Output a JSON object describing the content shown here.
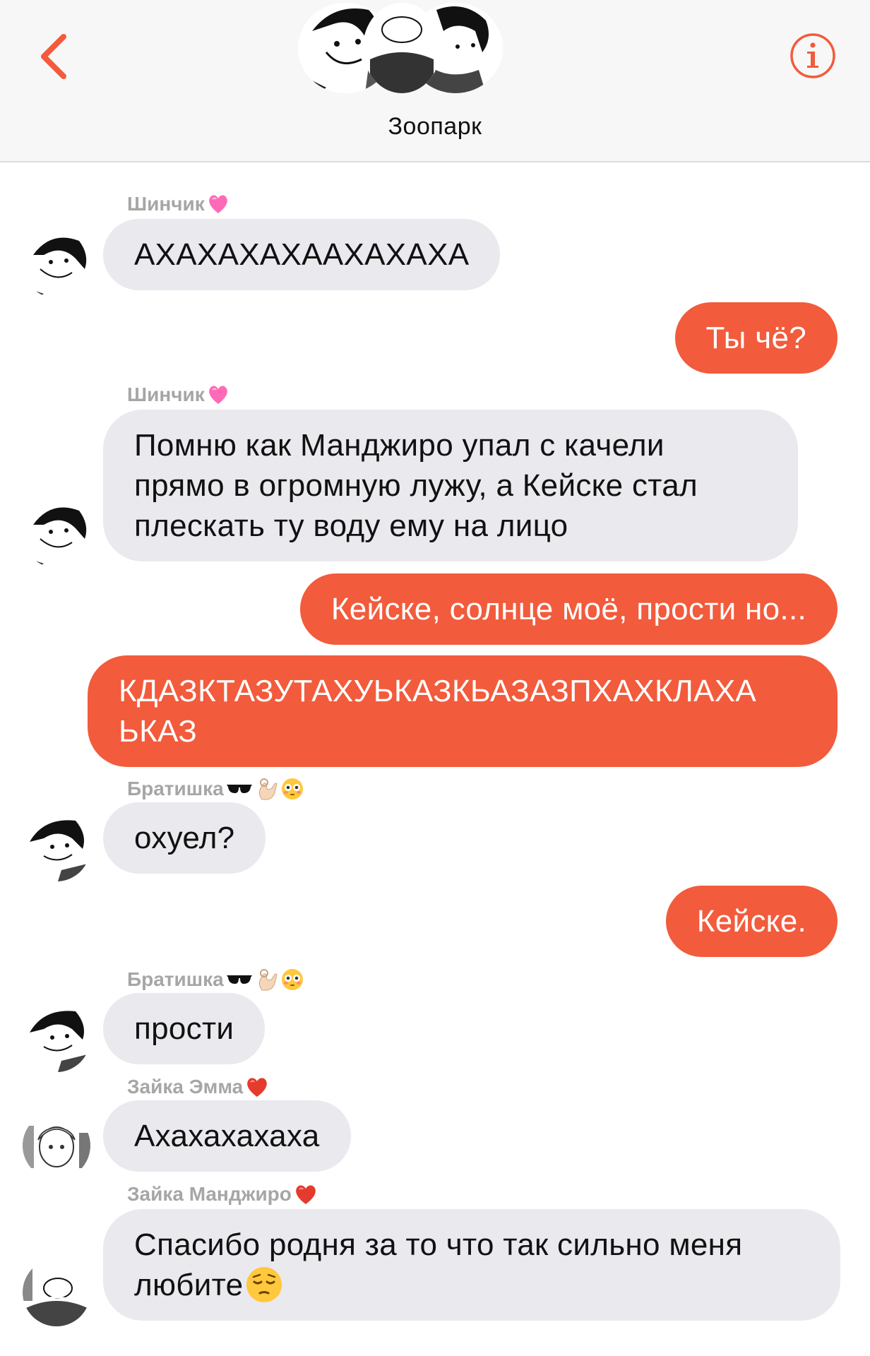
{
  "header": {
    "title": "Зоопарк",
    "back_icon": "chevron-left-icon",
    "info_icon": "info-circle-icon",
    "accent_color": "#f25b3c"
  },
  "messages": [
    {
      "side": "in",
      "sender": "Шинчик",
      "sender_emoji": [
        "pink-heart-emoji"
      ],
      "text": "АХАХАХАХААХАХАХА"
    },
    {
      "side": "out",
      "text": "Ты чё?"
    },
    {
      "side": "in",
      "sender": "Шинчик",
      "sender_emoji": [
        "pink-heart-emoji"
      ],
      "lines": [
        "Помню как Манджиро упал с качели",
        "прямо в огромную лужу, а Кейске стал",
        "плескать ту воду ему на лицо"
      ]
    },
    {
      "side": "out",
      "text": "Кейске, солнце моё, прости но..."
    },
    {
      "side": "out",
      "lines": [
        "КДАЗКТАЗУТАХУЬКАЗКЬАЗАЗПХАХКЛАХА",
        "ЬКАЗ"
      ]
    },
    {
      "side": "in",
      "sender": "Братишка",
      "sender_emoji": [
        "sunglasses-emoji",
        "ok-hand-emoji",
        "flushed-face-emoji"
      ],
      "text": "охуел?"
    },
    {
      "side": "out",
      "text": "Кейске."
    },
    {
      "side": "in",
      "sender": "Братишка",
      "sender_emoji": [
        "sunglasses-emoji",
        "ok-hand-emoji",
        "flushed-face-emoji"
      ],
      "text": "прости"
    },
    {
      "side": "in",
      "sender": "Зайка Эмма",
      "sender_emoji": [
        "red-heart-emoji"
      ],
      "text": "Ахахахахаха"
    },
    {
      "side": "in",
      "sender": "Зайка Манджиро",
      "sender_emoji": [
        "red-heart-emoji"
      ],
      "lines": [
        "Спасибо родня за то что так сильно меня",
        "любите"
      ],
      "trailing_emoji": "pensive-face-emoji"
    }
  ]
}
